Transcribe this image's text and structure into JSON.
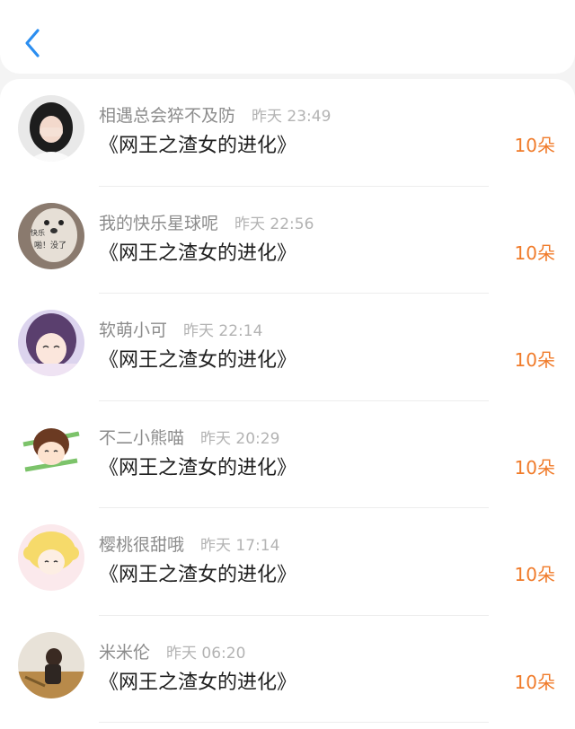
{
  "header": {
    "back_icon": "chevron-left-icon",
    "accent": "#2b8ef0"
  },
  "colors": {
    "amount": "#f07b2a",
    "username": "#8c8c8c",
    "time": "#b3b3b3"
  },
  "records": [
    {
      "user": "相遇总会猝不及防",
      "time": "昨天 23:49",
      "book": "《网王之渣女的进化》",
      "amount": "10朵"
    },
    {
      "user": "我的快乐星球呢",
      "time": "昨天 22:56",
      "book": "《网王之渣女的进化》",
      "amount": "10朵"
    },
    {
      "user": "软萌小可",
      "time": "昨天 22:14",
      "book": "《网王之渣女的进化》",
      "amount": "10朵"
    },
    {
      "user": "不二小熊喵",
      "time": "昨天 20:29",
      "book": "《网王之渣女的进化》",
      "amount": "10朵"
    },
    {
      "user": "樱桃很甜哦",
      "time": "昨天 17:14",
      "book": "《网王之渣女的进化》",
      "amount": "10朵"
    },
    {
      "user": "米米伦",
      "time": "昨天 06:20",
      "book": "《网王之渣女的进化》",
      "amount": "10朵"
    }
  ],
  "avatar_overlays": {
    "r1_line1": "快乐",
    "r1_line2": "啪！没了"
  }
}
